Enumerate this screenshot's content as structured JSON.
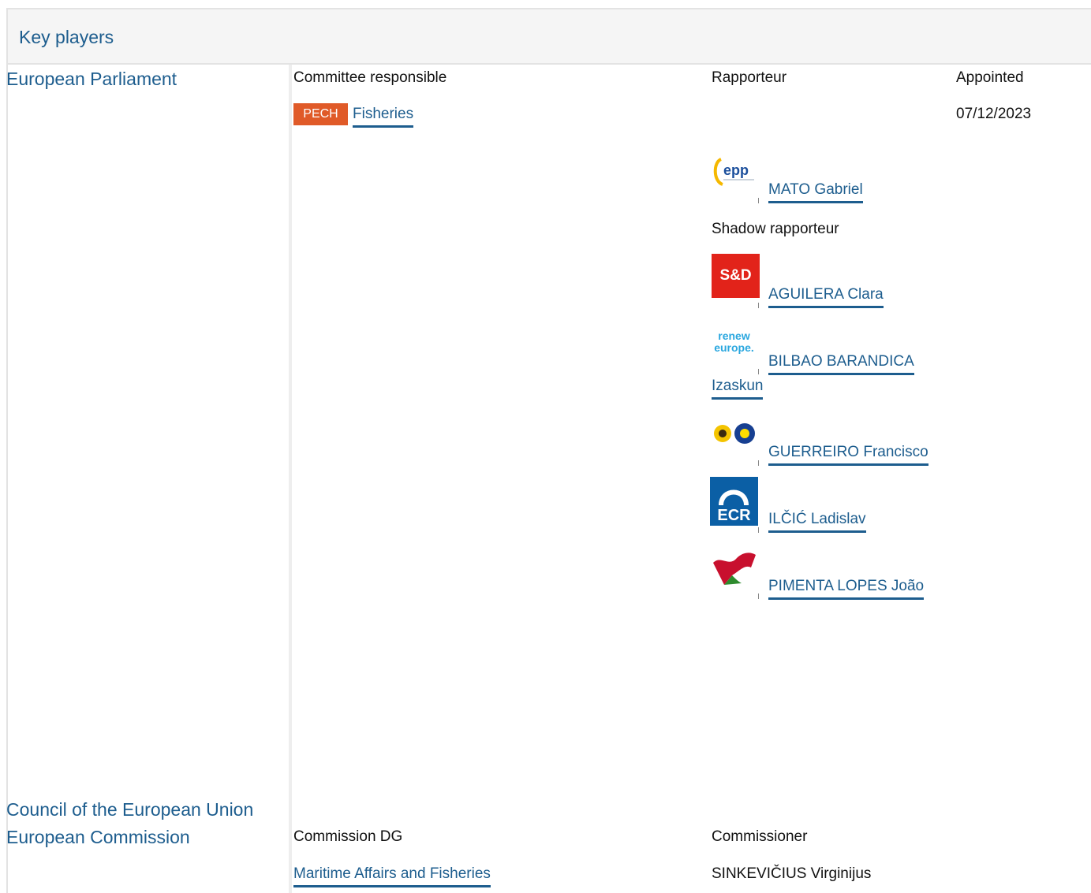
{
  "section_title": "Key players",
  "institutions": {
    "ep": "European Parliament",
    "council": "Council of the European Union",
    "commission": "European Commission"
  },
  "parliament": {
    "col_committee": "Committee responsible",
    "col_rapporteur": "Rapporteur",
    "col_appointed": "Appointed",
    "committee_code": "PECH",
    "committee_name": "Fisheries",
    "appointed_date": "07/12/2023",
    "rapporteur": {
      "name": "MATO Gabriel",
      "group_logo": "epp-logo"
    },
    "shadow_label": "Shadow rapporteur",
    "shadows": [
      {
        "name": "AGUILERA Clara",
        "group_logo": "sd-logo"
      },
      {
        "name_line1": "BILBAO BARANDICA",
        "name_line2": "Izaskun",
        "group_logo": "renew-europe-logo"
      },
      {
        "name": "GUERREIRO Francisco",
        "group_logo": "greens-efa-logo"
      },
      {
        "name": "ILČIĆ Ladislav",
        "group_logo": "ecr-logo"
      },
      {
        "name": "PIMENTA LOPES João",
        "group_logo": "left-logo"
      }
    ]
  },
  "commission": {
    "col_dg": "Commission DG",
    "col_commissioner": "Commissioner",
    "dg_name": "Maritime Affairs and Fisheries",
    "commissioner": "SINKEVIČIUS Virginijus"
  },
  "logos": {
    "epp": "epp",
    "sd": "S&D",
    "renew_line1": "renew",
    "renew_line2": "europe.",
    "ecr": "ECR"
  },
  "colors": {
    "link": "#1d5d8e",
    "tag_bg": "#e05a28",
    "sd_red": "#e2231a",
    "ecr_blue": "#0b5fa5"
  }
}
